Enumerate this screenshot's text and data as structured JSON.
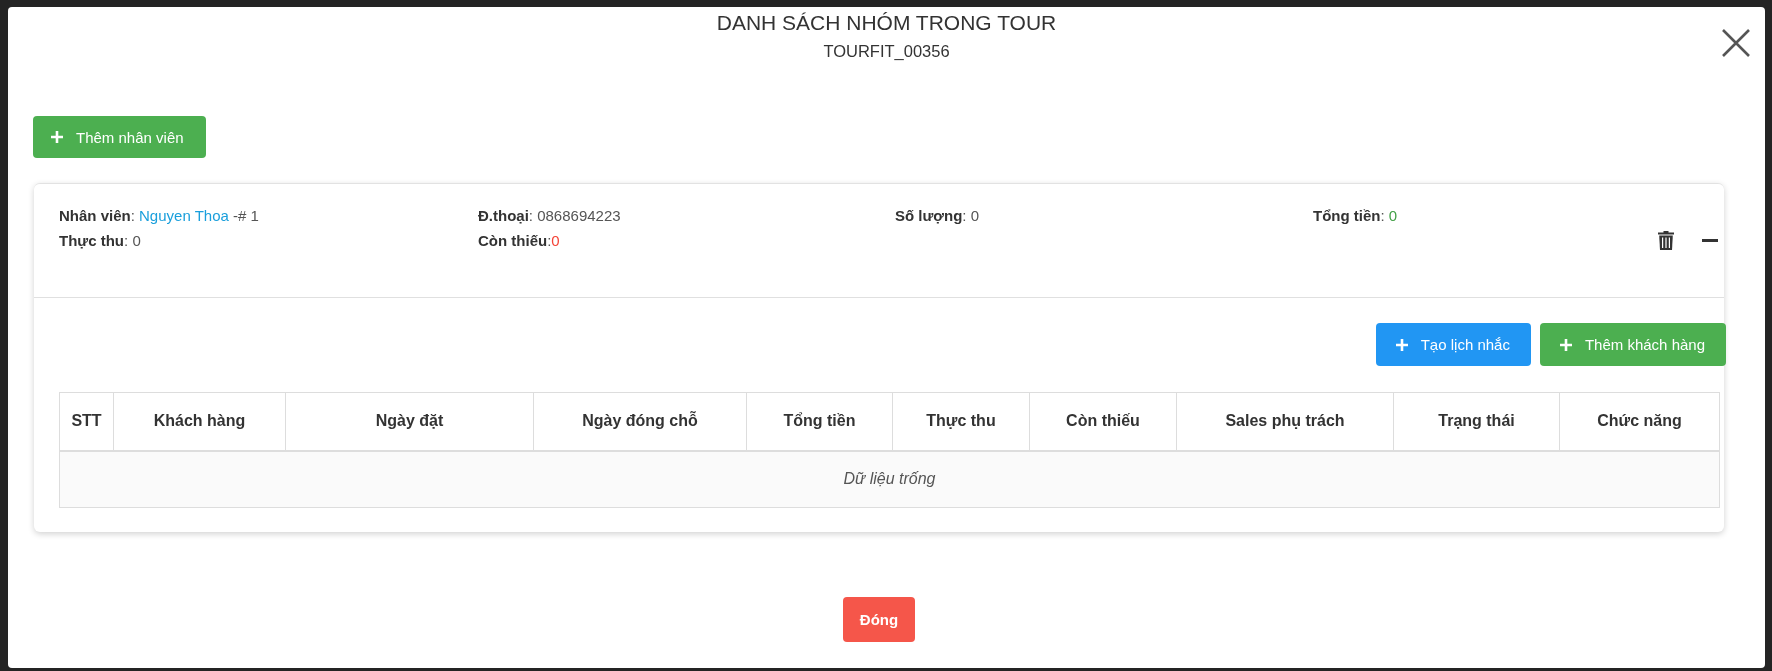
{
  "dialog": {
    "title": "DANH SÁCH NHÓM TRONG TOUR",
    "subtitle": "TOURFIT_00356"
  },
  "toolbar": {
    "add_button": "Thêm nhân viên"
  },
  "groups": [
    {
      "expanded": true,
      "fields": [
        {
          "label": "**Nhân viên**: ",
          "value": "Nguyen Thoa",
          "kind": "link",
          "suffix": " -# 1"
        },
        {
          "label": "**Đ.thoại**: ",
          "value": "0868694223",
          "kind": "plain"
        },
        {
          "label": "**Số lượng**: ",
          "value": "0",
          "kind": "plain"
        },
        {
          "label": "**Tổng tiền**: ",
          "value": "0",
          "kind": "positive"
        },
        {
          "label": "**Thực thu**: ",
          "value": "0",
          "kind": "plain"
        },
        {
          "label": "**Còn thiếu**:",
          "value": "0",
          "kind": "negative"
        }
      ],
      "actions": [
        {
          "label": "Tạo lịch nhắc",
          "kind": "primary"
        },
        {
          "label": "Thêm khách hàng",
          "kind": "success"
        }
      ],
      "table": {
        "columns": [
          "STT",
          "Khách hàng",
          "Ngày đặt",
          "Ngày đóng chỗ",
          "Tổng tiền",
          "Thực thu",
          "Còn thiếu",
          "Sales phụ trách",
          "Trạng thái",
          "Chức năng"
        ],
        "empty_text": "Dữ liệu trống"
      }
    }
  ],
  "footer": {
    "close_button": "Đóng"
  }
}
